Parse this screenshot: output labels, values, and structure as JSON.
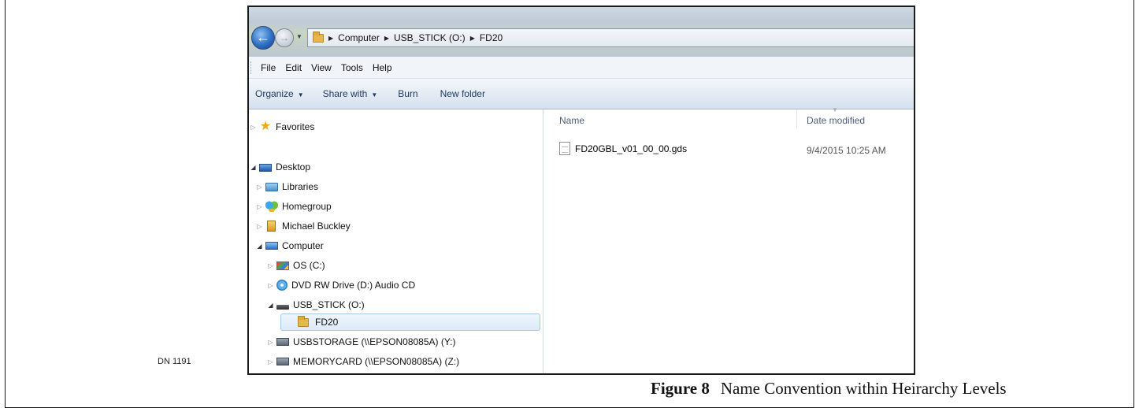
{
  "document": {
    "label": "DN 1191",
    "caption_number": "Figure 8",
    "caption_text": "Name Convention within Heirarchy Levels"
  },
  "explorer": {
    "breadcrumbs": [
      "Computer",
      "USB_STICK (O:)",
      "FD20"
    ],
    "menu": [
      "File",
      "Edit",
      "View",
      "Tools",
      "Help"
    ],
    "toolbar": {
      "organize": "Organize",
      "share_with": "Share with",
      "burn": "Burn",
      "new_folder": "New folder"
    },
    "tree": {
      "favorites": "Favorites",
      "desktop": "Desktop",
      "libraries": "Libraries",
      "homegroup": "Homegroup",
      "user": "Michael Buckley",
      "computer": "Computer",
      "drive_c": "OS (C:)",
      "drive_d": "DVD RW Drive (D:) Audio CD",
      "drive_o": "USB_STICK (O:)",
      "fd20": "FD20",
      "drive_y": "USBSTORAGE (\\\\EPSON08085A) (Y:)",
      "drive_z": "MEMORYCARD (\\\\EPSON08085A) (Z:)"
    },
    "columns": {
      "name": "Name",
      "date_modified": "Date modified"
    },
    "files": [
      {
        "name": "FD20GBL_v01_00_00.gds",
        "date": "9/4/2015 10:25 AM"
      }
    ]
  }
}
